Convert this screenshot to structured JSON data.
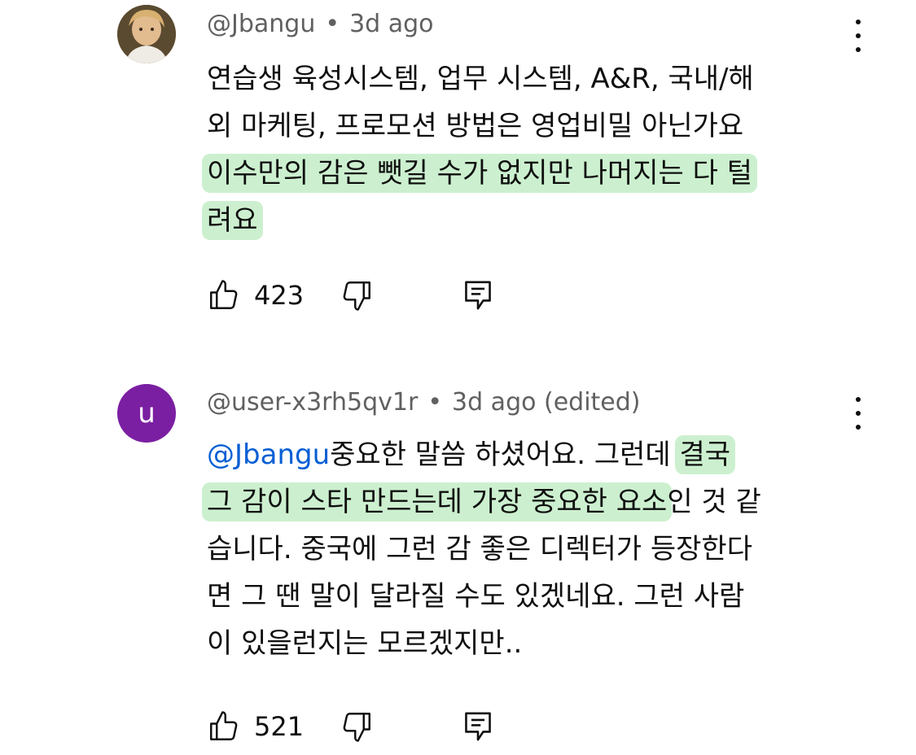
{
  "comments": [
    {
      "author": "@Jbangu",
      "separator": "•",
      "time": "3d ago",
      "avatar_letter": "",
      "lines": [
        {
          "parts": [
            {
              "text": "연습생 육성시스템, 업무 시스템, A&R, 국내/해",
              "hl": false
            }
          ]
        },
        {
          "parts": [
            {
              "text": "외 마케팅, 프로모션 방법은 영업비밀 아닌가요",
              "hl": false
            }
          ]
        },
        {
          "parts": [
            {
              "text": "이수만의 감은 뺏길 수가 없지만 나머지는 다 털",
              "hl": true
            }
          ]
        },
        {
          "parts": [
            {
              "text": "려요",
              "hl": true
            }
          ]
        }
      ],
      "likes": "423"
    },
    {
      "author": "@user-x3rh5qv1r",
      "separator": "•",
      "time": "3d ago (edited)",
      "avatar_letter": "u",
      "avatar_color": "#7b1fa2",
      "mention": "@Jbangu",
      "lines": [
        {
          "parts": [
            {
              "text": "중요한 말씀 하셨어요. 그런데 ",
              "hl": false
            },
            {
              "text": "결국",
              "hl": true
            }
          ]
        },
        {
          "parts": [
            {
              "text": "그 감이 스타 만드는데 가장 중요한 요소",
              "hl": true
            },
            {
              "text": "인 것 같",
              "hl": false
            }
          ]
        },
        {
          "parts": [
            {
              "text": "습니다. 중국에 그런 감 좋은 디렉터가 등장한다",
              "hl": false
            }
          ]
        },
        {
          "parts": [
            {
              "text": "면 그 땐 말이 달라질 수도 있겠네요. 그런 사람",
              "hl": false
            }
          ]
        },
        {
          "parts": [
            {
              "text": "이 있을런지는 모르겠지만..",
              "hl": false
            }
          ]
        }
      ],
      "likes": "521"
    }
  ],
  "icons": {
    "like": "thumbs-up-icon",
    "dislike": "thumbs-down-icon",
    "reply": "reply-comment-icon",
    "more": "more-vertical-icon"
  },
  "colors": {
    "highlight": "#9ee6a8",
    "mention": "#065fd4",
    "avatar_u": "#7b1fa2",
    "meta_text": "#606060"
  }
}
